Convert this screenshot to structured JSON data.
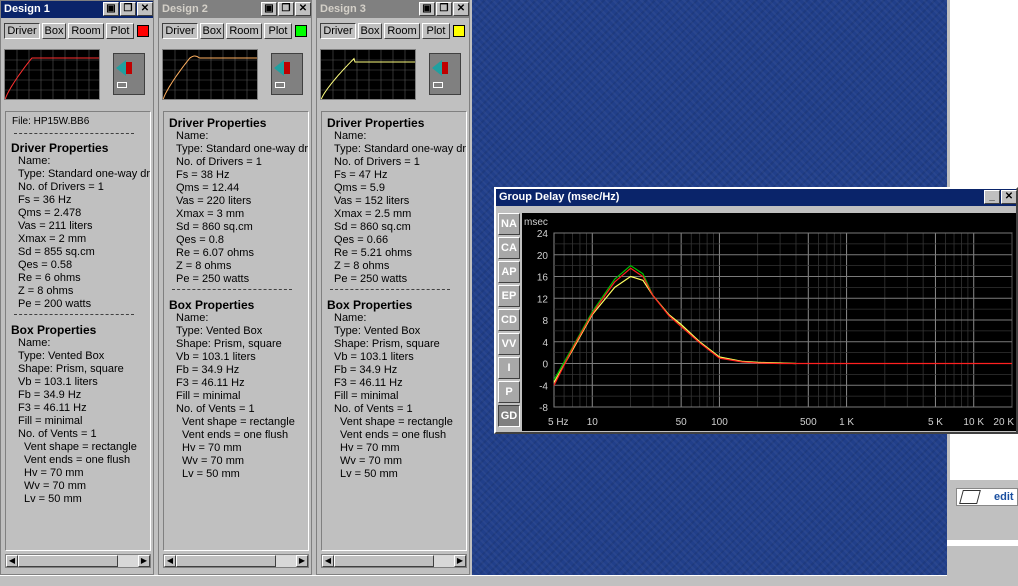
{
  "panels": [
    {
      "title": "Design 1",
      "active": true,
      "swatch": "#ff0000",
      "curve_color": "#ff3030",
      "tabs": [
        "Driver",
        "Box",
        "Room",
        "Plot"
      ],
      "file": "File: HP15W.BB6",
      "driver_heading": "Driver Properties",
      "driver": [
        "Name:",
        "Type: Standard one-way driv",
        "No. of Drivers = 1",
        "Fs = 36 Hz",
        "Qms = 2.478",
        "Vas = 211 liters",
        "Xmax = 2 mm",
        "Sd = 855 sq.cm",
        "Qes = 0.58",
        "Re = 6 ohms",
        "Z = 8 ohms",
        "Pe = 200 watts"
      ],
      "box_heading": "Box Properties",
      "box": [
        "Name:",
        "Type: Vented Box",
        "Shape: Prism, square",
        "Vb = 103.1 liters",
        "Fb = 34.9 Hz",
        "F3 = 46.11 Hz",
        "Fill = minimal",
        "No. of Vents = 1",
        "  Vent shape = rectangle",
        "  Vent ends = one flush",
        "  Hv = 70 mm",
        "  Wv = 70 mm",
        "  Lv = 50 mm"
      ]
    },
    {
      "title": "Design 2",
      "active": false,
      "swatch": "#00ff00",
      "curve_color": "#ffb060",
      "tabs": [
        "Driver",
        "Box",
        "Room",
        "Plot"
      ],
      "file": "",
      "driver_heading": "Driver Properties",
      "driver": [
        "Name:",
        "Type: Standard one-way driv",
        "No. of Drivers = 1",
        "Fs = 38 Hz",
        "Qms = 12.44",
        "Vas = 220 liters",
        "Xmax = 3 mm",
        "Sd = 860 sq.cm",
        "Qes = 0.8",
        "Re = 6.07 ohms",
        "Z = 8 ohms",
        "Pe = 250 watts"
      ],
      "box_heading": "Box Properties",
      "box": [
        "Name:",
        "Type: Vented Box",
        "Shape: Prism, square",
        "Vb = 103.1 liters",
        "Fb = 34.9 Hz",
        "F3 = 46.11 Hz",
        "Fill = minimal",
        "No. of Vents = 1",
        "  Vent shape = rectangle",
        "  Vent ends = one flush",
        "  Hv = 70 mm",
        "  Wv = 70 mm",
        "  Lv = 50 mm"
      ]
    },
    {
      "title": "Design 3",
      "active": false,
      "swatch": "#ffff00",
      "curve_color": "#ffff80",
      "tabs": [
        "Driver",
        "Box",
        "Room",
        "Plot"
      ],
      "file": "",
      "driver_heading": "Driver Properties",
      "driver": [
        "Name:",
        "Type: Standard one-way driv",
        "No. of Drivers = 1",
        "Fs = 47 Hz",
        "Qms = 5.9",
        "Vas = 152 liters",
        "Xmax = 2.5 mm",
        "Sd = 860 sq.cm",
        "Qes = 0.66",
        "Re = 5.21 ohms",
        "Z = 8 ohms",
        "Pe = 250 watts"
      ],
      "box_heading": "Box Properties",
      "box": [
        "Name:",
        "Type: Vented Box",
        "Shape: Prism, square",
        "Vb = 103.1 liters",
        "Fb = 34.9 Hz",
        "F3 = 46.11 Hz",
        "Fill = minimal",
        "No. of Vents = 1",
        "  Vent shape = rectangle",
        "  Vent ends = one flush",
        "  Hv = 70 mm",
        "  Wv = 70 mm",
        "  Lv = 50 mm"
      ]
    }
  ],
  "group_delay": {
    "title": "Group Delay (msec/Hz)",
    "side_buttons": [
      "NA",
      "CA",
      "AP",
      "EP",
      "CD",
      "VV",
      "I",
      "P",
      "GD"
    ],
    "selected": "GD",
    "unit_label": "msec",
    "chart_data": {
      "type": "line",
      "xscale": "log",
      "xlim": [
        5,
        20000
      ],
      "ylim": [
        -8,
        24
      ],
      "grid": true,
      "y_ticks": [
        24,
        20,
        16,
        12,
        8,
        4,
        0,
        -4,
        -8
      ],
      "x_tick_labels": [
        {
          "v": 5,
          "t": "5 Hz"
        },
        {
          "v": 10,
          "t": "10"
        },
        {
          "v": 50,
          "t": "50"
        },
        {
          "v": 100,
          "t": "100"
        },
        {
          "v": 500,
          "t": "500"
        },
        {
          "v": 1000,
          "t": "1 K"
        },
        {
          "v": 5000,
          "t": "5 K"
        },
        {
          "v": 10000,
          "t": "10 K"
        },
        {
          "v": 20000,
          "t": "20 K"
        }
      ],
      "series": [
        {
          "color": "#00c000",
          "x": [
            5,
            7,
            10,
            15,
            20,
            25,
            30,
            40,
            50,
            70,
            100,
            150,
            200,
            300,
            400
          ],
          "y": [
            -3,
            3,
            9.5,
            15.5,
            18,
            16.5,
            12.5,
            9,
            7,
            4,
            1.2,
            0.4,
            0.2,
            0.1,
            0
          ]
        },
        {
          "color": "#ffff60",
          "x": [
            5,
            7,
            10,
            15,
            20,
            25,
            30,
            40,
            50,
            70,
            100,
            150,
            200,
            300,
            400
          ],
          "y": [
            -3.5,
            2.5,
            9,
            14,
            16,
            15.3,
            12.5,
            9,
            7.2,
            4,
            1.2,
            0.4,
            0.2,
            0.1,
            0
          ]
        },
        {
          "color": "#ff2020",
          "x": [
            5,
            7,
            10,
            15,
            20,
            25,
            30,
            40,
            50,
            70,
            100,
            150,
            200,
            300,
            400,
            1000,
            5000,
            20000
          ],
          "y": [
            -4,
            2.8,
            9.2,
            15,
            17.5,
            16,
            12.5,
            8.8,
            6.8,
            3.8,
            1,
            0.3,
            0.1,
            0,
            0,
            0,
            0,
            0
          ]
        }
      ]
    }
  },
  "edit_label": "edit"
}
